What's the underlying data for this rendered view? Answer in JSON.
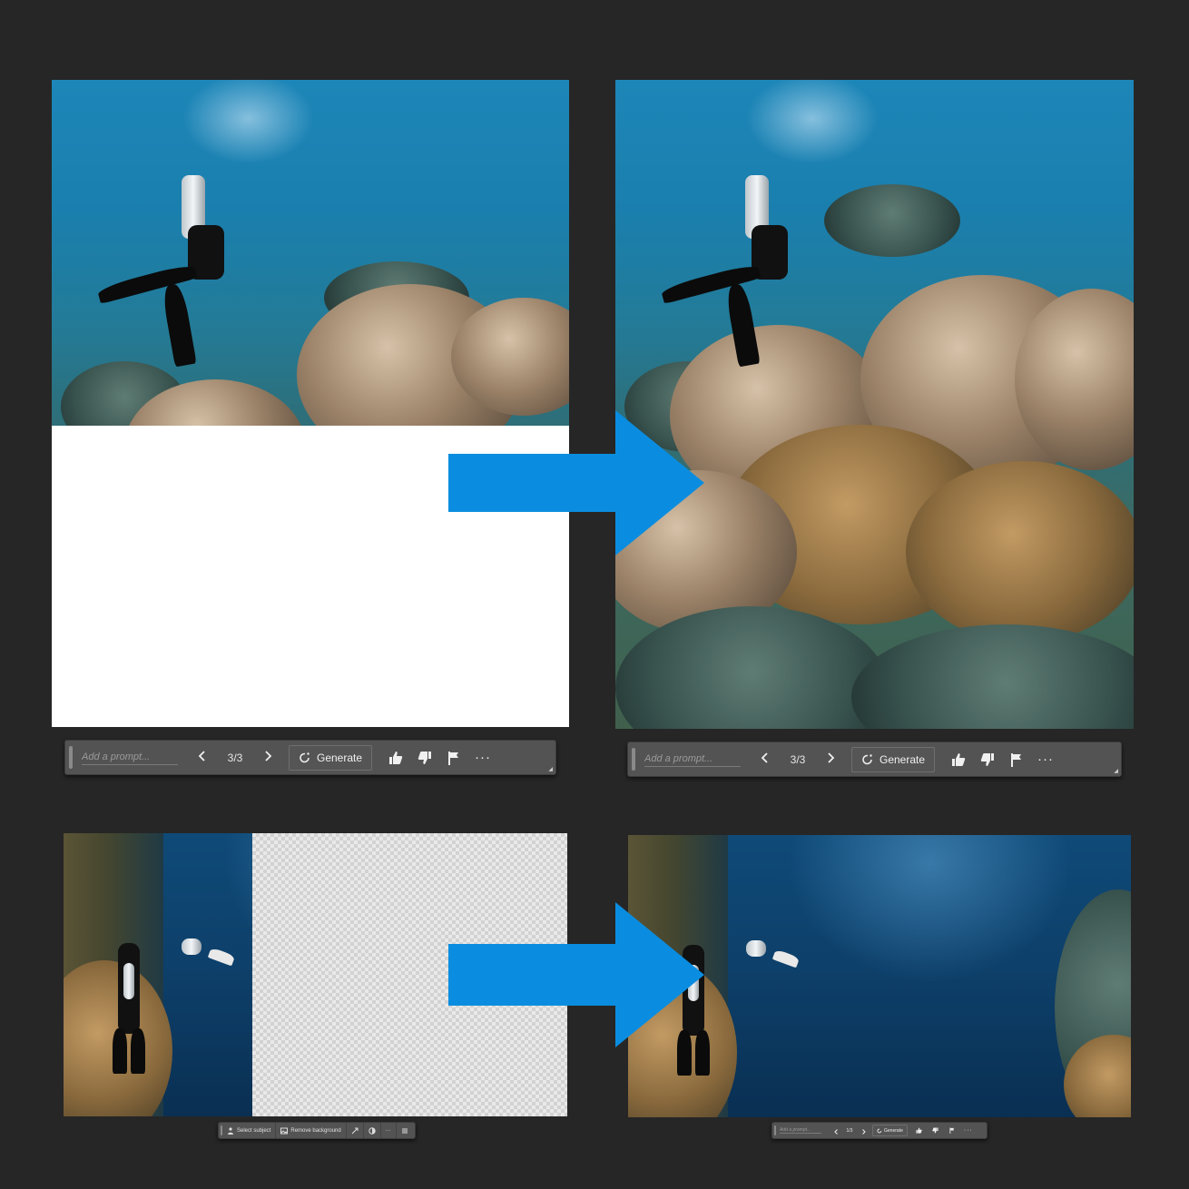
{
  "toolbars": {
    "top_left": {
      "prompt_placeholder": "Add a prompt...",
      "counter": "3/3",
      "generate_label": "Generate",
      "more_label": "···"
    },
    "top_right": {
      "prompt_placeholder": "Add a prompt...",
      "counter": "3/3",
      "generate_label": "Generate",
      "more_label": "···"
    },
    "bottom_left": {
      "select_subject_label": "Select subject",
      "remove_background_label": "Remove background",
      "more_label": "···"
    },
    "bottom_right": {
      "prompt_placeholder": "Add a prompt...",
      "counter": "1/3",
      "generate_label": "Generate",
      "more_label": "···"
    }
  },
  "icons": [
    "thumbs-up-icon",
    "thumbs-down-icon",
    "flag-icon",
    "generate-icon",
    "chevron-left-icon",
    "chevron-right-icon"
  ],
  "colors": {
    "background": "#262626",
    "arrow": "#0a8de0",
    "toolbar": "#535353"
  }
}
